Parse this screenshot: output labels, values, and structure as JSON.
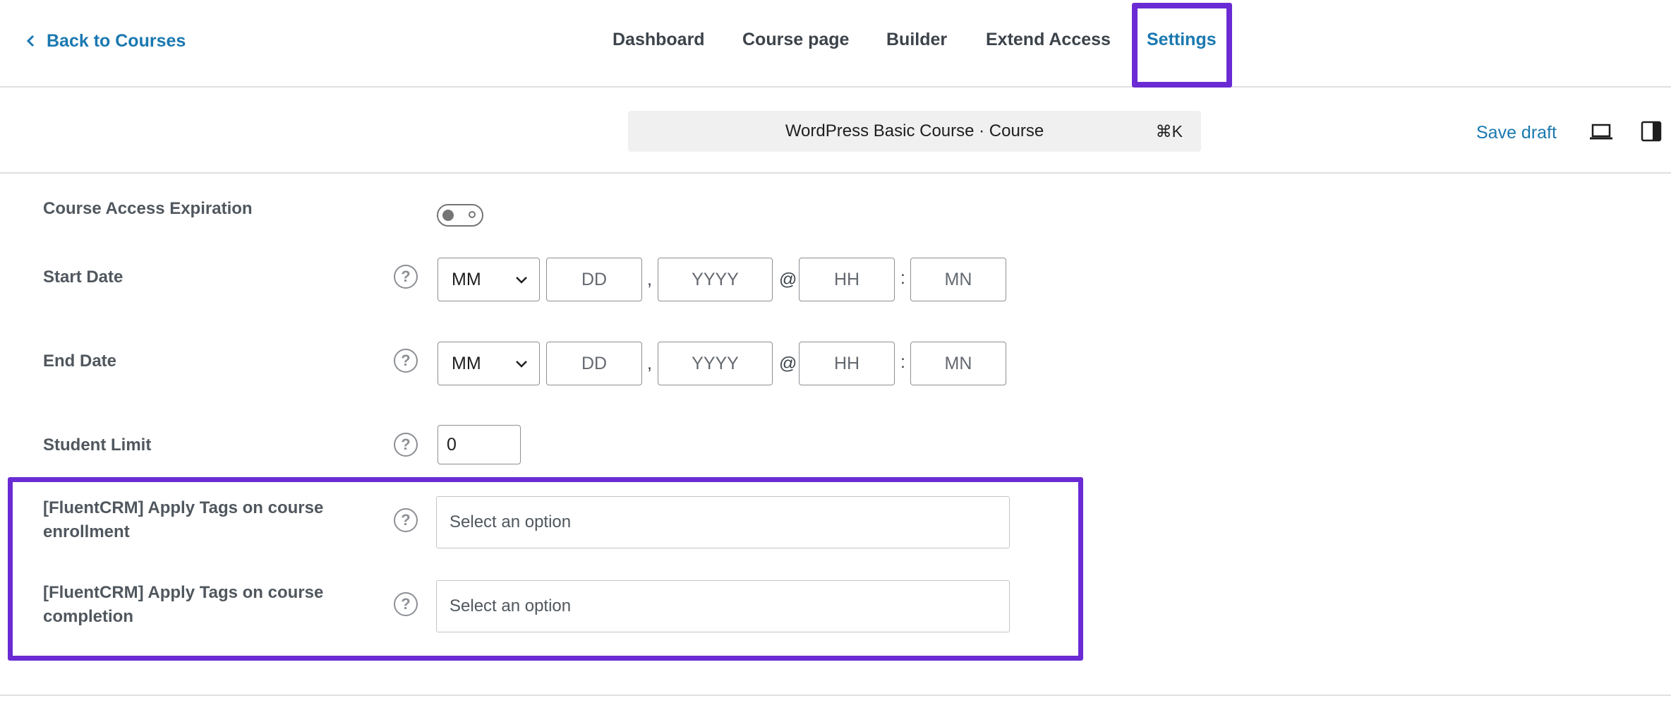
{
  "header": {
    "back_label": "Back to Courses",
    "tabs": [
      {
        "label": "Dashboard",
        "active": false
      },
      {
        "label": "Course page",
        "active": false
      },
      {
        "label": "Builder",
        "active": false
      },
      {
        "label": "Extend Access",
        "active": false
      },
      {
        "label": "Settings",
        "active": true
      }
    ]
  },
  "toolbar": {
    "command_text": "WordPress Basic Course · Course",
    "shortcut": "⌘K",
    "save_draft": "Save draft",
    "icons": [
      "desktop-preview-icon",
      "sidebar-toggle-icon"
    ]
  },
  "settings": {
    "access_expiration": {
      "label": "Course Access Expiration",
      "enabled": false
    },
    "start_date": {
      "label": "Start Date",
      "month": "MM",
      "day_placeholder": "DD",
      "year_placeholder": "YYYY",
      "hour_placeholder": "HH",
      "minute_placeholder": "MN"
    },
    "end_date": {
      "label": "End Date",
      "month": "MM",
      "day_placeholder": "DD",
      "year_placeholder": "YYYY",
      "hour_placeholder": "HH",
      "minute_placeholder": "MN"
    },
    "separators": {
      "comma": ",",
      "at": "@",
      "colon": ":"
    },
    "student_limit": {
      "label": "Student Limit",
      "value": "0"
    },
    "fluentcrm_enrollment": {
      "label_line1": "[FluentCRM] Apply Tags on course",
      "label_line2": "enrollment",
      "placeholder": "Select an option"
    },
    "fluentcrm_completion": {
      "label_line1": "[FluentCRM] Apply Tags on course",
      "label_line2": "completion",
      "placeholder": "Select an option"
    },
    "help_glyph": "?"
  },
  "colors": {
    "accent": "#1a78b0",
    "highlight": "#6a2bd4",
    "label": "#50575e"
  }
}
